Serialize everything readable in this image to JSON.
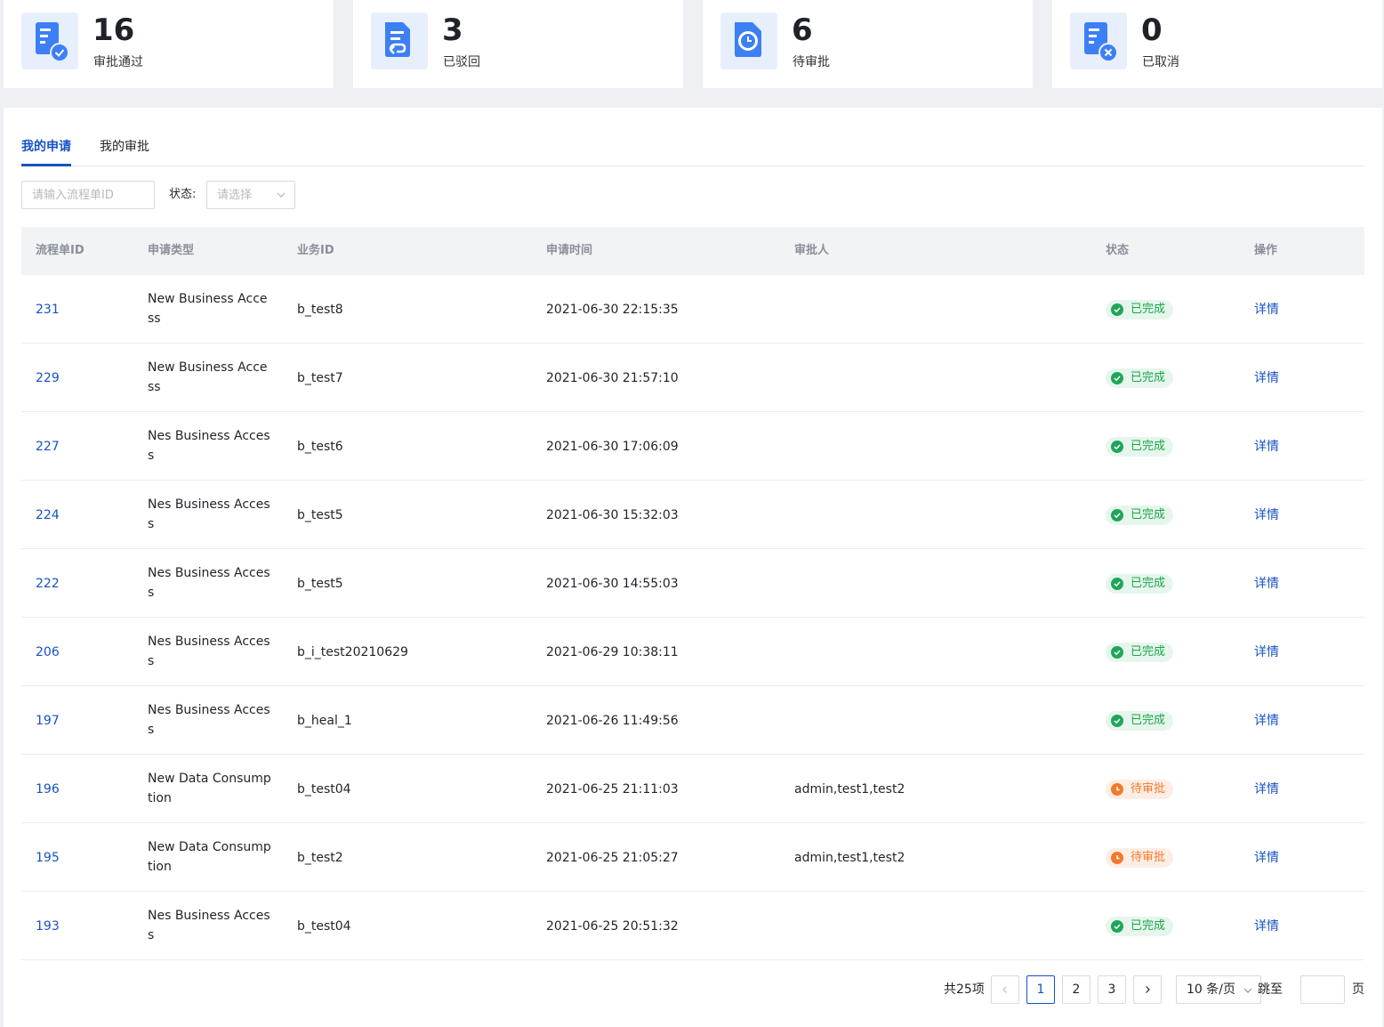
{
  "colors": {
    "accent": "#1552c4",
    "success": "#21a659",
    "warning": "#f27a2a",
    "icon_blue": "#3d7ff5"
  },
  "stats": [
    {
      "value": "16",
      "label": "审批通过",
      "icon": "approved-doc-icon"
    },
    {
      "value": "3",
      "label": "已驳回",
      "icon": "rejected-doc-icon"
    },
    {
      "value": "6",
      "label": "待审批",
      "icon": "pending-clock-icon"
    },
    {
      "value": "0",
      "label": "已取消",
      "icon": "cancelled-doc-icon"
    }
  ],
  "tabs": [
    {
      "label": "我的申请",
      "active": true
    },
    {
      "label": "我的审批",
      "active": false
    }
  ],
  "filters": {
    "search_placeholder": "请输入流程单ID",
    "status_label": "状态:",
    "status_placeholder": "请选择"
  },
  "table": {
    "columns": [
      "流程单ID",
      "申请类型",
      "业务ID",
      "申请时间",
      "审批人",
      "状态",
      "操作"
    ],
    "rows": [
      {
        "id": "231",
        "type": "New Business Access",
        "biz_id": "b_test8",
        "time": "2021-06-30 22:15:35",
        "approver": "",
        "status": "已完成",
        "status_kind": "done",
        "action": "详情"
      },
      {
        "id": "229",
        "type": "New Business Access",
        "biz_id": "b_test7",
        "time": "2021-06-30 21:57:10",
        "approver": "",
        "status": "已完成",
        "status_kind": "done",
        "action": "详情"
      },
      {
        "id": "227",
        "type": "Nes Business Access",
        "biz_id": "b_test6",
        "time": "2021-06-30 17:06:09",
        "approver": "",
        "status": "已完成",
        "status_kind": "done",
        "action": "详情"
      },
      {
        "id": "224",
        "type": "Nes Business Access",
        "biz_id": "b_test5",
        "time": "2021-06-30 15:32:03",
        "approver": "",
        "status": "已完成",
        "status_kind": "done",
        "action": "详情"
      },
      {
        "id": "222",
        "type": "Nes Business Access",
        "biz_id": "b_test5",
        "time": "2021-06-30 14:55:03",
        "approver": "",
        "status": "已完成",
        "status_kind": "done",
        "action": "详情"
      },
      {
        "id": "206",
        "type": "Nes Business Access",
        "biz_id": "b_i_test20210629",
        "time": "2021-06-29 10:38:11",
        "approver": "",
        "status": "已完成",
        "status_kind": "done",
        "action": "详情"
      },
      {
        "id": "197",
        "type": "Nes Business Access",
        "biz_id": "b_heal_1",
        "time": "2021-06-26 11:49:56",
        "approver": "",
        "status": "已完成",
        "status_kind": "done",
        "action": "详情"
      },
      {
        "id": "196",
        "type": "New Data Consumption",
        "biz_id": "b_test04",
        "time": "2021-06-25 21:11:03",
        "approver": "admin,test1,test2",
        "status": "待审批",
        "status_kind": "pending",
        "action": "详情"
      },
      {
        "id": "195",
        "type": "New Data Consumption",
        "biz_id": "b_test2",
        "time": "2021-06-25 21:05:27",
        "approver": "admin,test1,test2",
        "status": "待审批",
        "status_kind": "pending",
        "action": "详情"
      },
      {
        "id": "193",
        "type": "Nes Business Access",
        "biz_id": "b_test04",
        "time": "2021-06-25 20:51:32",
        "approver": "",
        "status": "已完成",
        "status_kind": "done",
        "action": "详情"
      }
    ]
  },
  "pagination": {
    "total_text": "共25项",
    "prev": "<",
    "pages": [
      "1",
      "2",
      "3"
    ],
    "current": "1",
    "next": ">",
    "page_size": "10 条/页",
    "jump_label": "跳至",
    "jump_unit": "页"
  }
}
